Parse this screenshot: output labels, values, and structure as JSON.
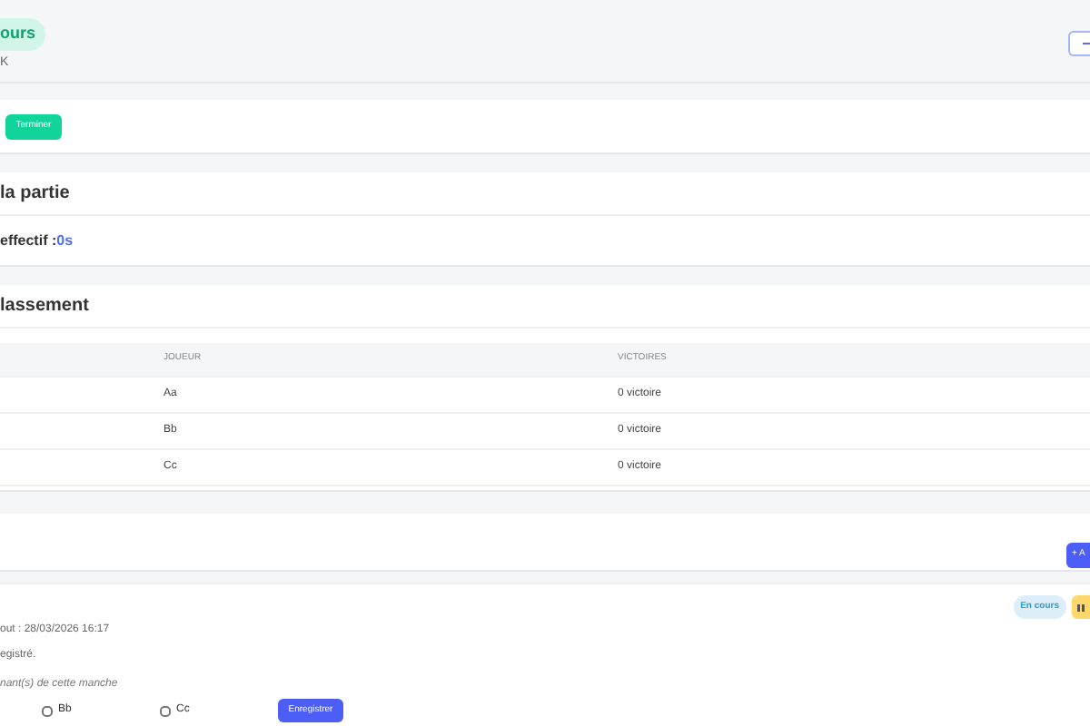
{
  "header": {
    "status_badge": "ours",
    "subtitle": "K"
  },
  "actions": {
    "finish_button": "Terminer"
  },
  "game": {
    "title": "la partie",
    "time_label": "effectif : ",
    "time_value": "0s"
  },
  "ranking": {
    "title": "lassement",
    "columns": [
      "JOUEUR",
      "VICTOIRES"
    ],
    "rows": [
      {
        "player": "Aa",
        "wins": "0 victoire"
      },
      {
        "player": "Bb",
        "wins": "0 victoire"
      },
      {
        "player": "Cc",
        "wins": "0 victoire"
      }
    ]
  },
  "rounds": {
    "add_button": "+ A"
  },
  "round": {
    "status_badge": "En cours",
    "started": "out : 28/03/2026 16:17",
    "note": "egistré.",
    "winners_label": "nant(s) de cette manche",
    "players": [
      {
        "name": "Bb",
        "checked": false
      },
      {
        "name": "Cc",
        "checked": false
      }
    ],
    "save_button": "Enregistrer"
  }
}
